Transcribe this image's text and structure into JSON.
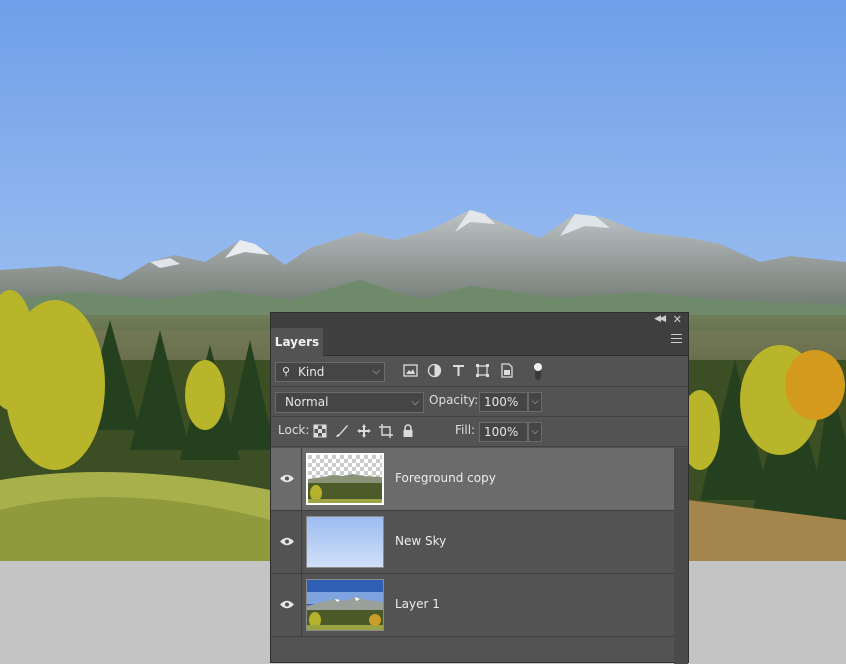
{
  "panel": {
    "tab_label": "Layers",
    "filter": {
      "kind_label": "Kind"
    },
    "blend_mode": "Normal",
    "opacity_label": "Opacity:",
    "opacity_value": "100%",
    "lock_label": "Lock:",
    "fill_label": "Fill:",
    "fill_value": "100%",
    "filter_icons": [
      "image-filter-icon",
      "adjustment-filter-icon",
      "type-filter-icon",
      "shape-filter-icon",
      "smart-object-filter-icon"
    ],
    "lock_icons": [
      "lock-transparent-icon",
      "lock-image-icon",
      "lock-position-icon",
      "lock-artboard-icon",
      "lock-all-icon"
    ]
  },
  "layers": [
    {
      "name": "Foreground copy",
      "selected": true,
      "visible": true
    },
    {
      "name": "New Sky",
      "selected": false,
      "visible": true
    },
    {
      "name": "Layer 1",
      "selected": false,
      "visible": true
    }
  ],
  "colors": {
    "panel_bg": "#535353",
    "selected_row": "#6b6b6b",
    "sky_top": "#6f9fe9",
    "sky_bottom": "#b6d0f3"
  }
}
